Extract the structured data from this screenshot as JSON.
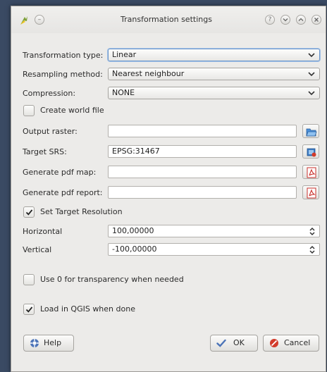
{
  "window": {
    "title": "Transformation settings"
  },
  "form": {
    "transformation_type": {
      "label": "Transformation type:",
      "value": "Linear"
    },
    "resampling_method": {
      "label": "Resampling method:",
      "value": "Nearest neighbour"
    },
    "compression": {
      "label": "Compression:",
      "value": "NONE"
    },
    "create_world_file": {
      "label": "Create world file",
      "checked": false
    },
    "output_raster": {
      "label": "Output raster:",
      "value": ""
    },
    "target_srs": {
      "label": "Target SRS:",
      "value": "EPSG:31467"
    },
    "generate_pdf_map": {
      "label": "Generate pdf map:",
      "value": ""
    },
    "generate_pdf_report": {
      "label": "Generate pdf report:",
      "value": ""
    },
    "set_target_resolution": {
      "label": "Set Target Resolution",
      "checked": true
    },
    "horizontal": {
      "label": "Horizontal",
      "value": "100,00000"
    },
    "vertical": {
      "label": "Vertical",
      "value": "-100,00000"
    },
    "use_zero_transparency": {
      "label": "Use 0 for transparency when needed",
      "checked": false
    },
    "load_in_qgis": {
      "label": "Load in QGIS when done",
      "checked": true
    }
  },
  "buttons": {
    "help": "Help",
    "ok": "OK",
    "cancel": "Cancel"
  },
  "icons": {
    "app": "qgis-logo-icon",
    "output_raster": "folder-open-icon",
    "target_srs": "crs-select-icon",
    "pdf_map": "pdf-icon",
    "pdf_report": "pdf-icon"
  },
  "colors": {
    "accent": "#6a95c9",
    "cancel_red": "#d23b2b",
    "ok_blue": "#4c74b8"
  }
}
